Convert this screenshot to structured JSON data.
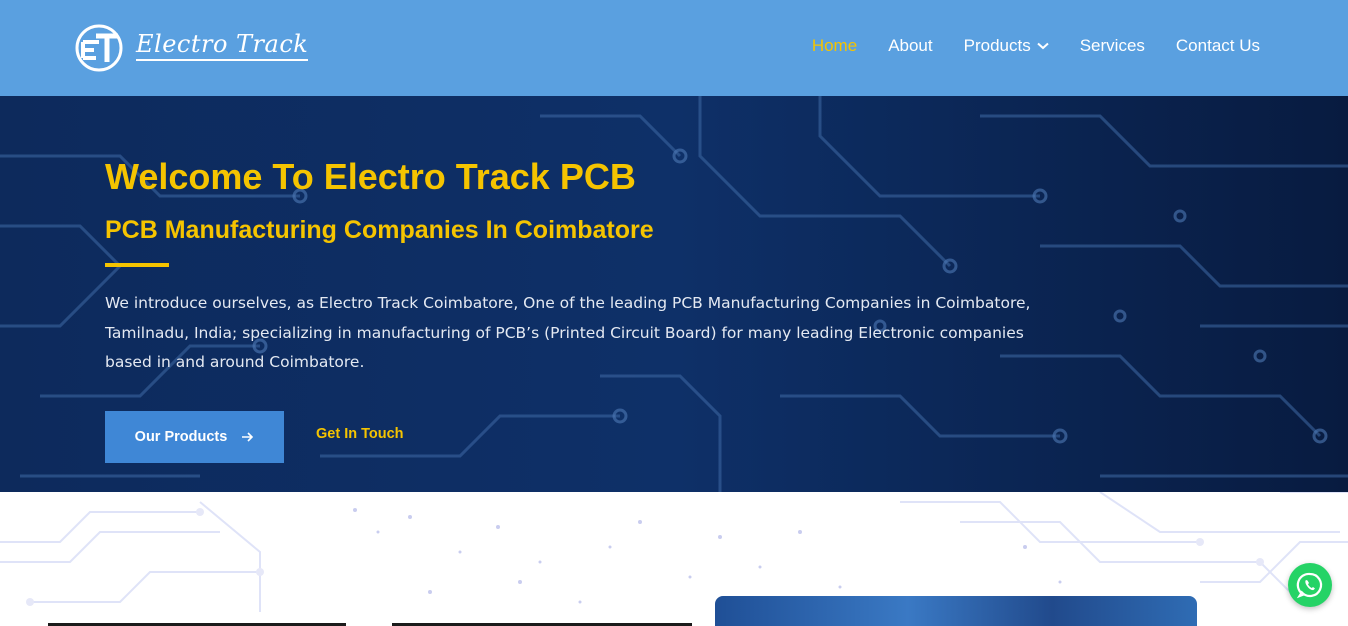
{
  "header": {
    "logo_text": "Electro Track",
    "nav": [
      {
        "label": "Home",
        "active": true
      },
      {
        "label": "About",
        "active": false
      },
      {
        "label": "Products",
        "active": false,
        "has_dropdown": true
      },
      {
        "label": "Services",
        "active": false
      },
      {
        "label": "Contact Us",
        "active": false
      }
    ]
  },
  "hero": {
    "title": "Welcome To Electro Track PCB",
    "subtitle": "PCB Manufacturing Companies In Coimbatore",
    "description": "We introduce ourselves, as Electro Track Coimbatore, One of the leading PCB Manufacturing Companies in Coimbatore, Tamilnadu, India; specializing in manufacturing of PCB’s (Printed Circuit Board) for many leading Electronic companies based in and around Coimbatore.",
    "primary_button": "Our Products",
    "secondary_button": "Get In Touch"
  },
  "colors": {
    "header_bg": "#5aa0e0",
    "accent_yellow": "#f5c400",
    "hero_bg": "#0b2350",
    "button_blue": "#3f87d6",
    "whatsapp_green": "#25d366"
  },
  "icons": {
    "logo": "et-monogram-icon",
    "dropdown": "chevron-down-icon",
    "button_arrow": "arrow-right-icon",
    "floating": "whatsapp-icon"
  }
}
